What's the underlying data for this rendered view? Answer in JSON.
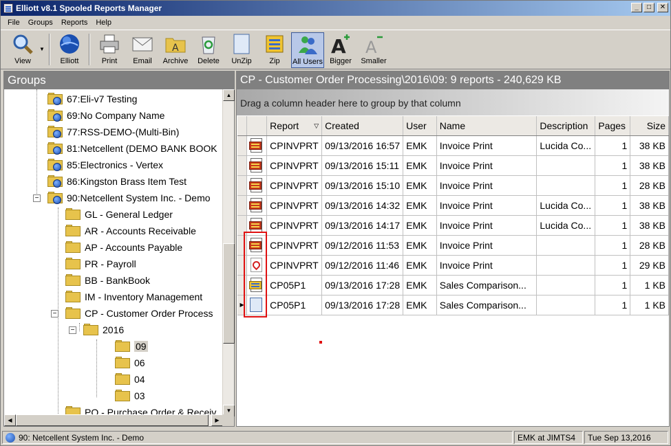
{
  "window": {
    "title": "Elliott v8.1 Spooled Reports Manager"
  },
  "menu": [
    "File",
    "Groups",
    "Reports",
    "Help"
  ],
  "toolbar": {
    "view": "View",
    "elliott": "Elliott",
    "print": "Print",
    "email": "Email",
    "archive": "Archive",
    "delete": "Delete",
    "unzip": "UnZip",
    "zip": "Zip",
    "all_users": "All Users",
    "bigger": "Bigger",
    "smaller": "Smaller"
  },
  "groups": {
    "header": "Groups",
    "tree": [
      {
        "label": "67:Eli-v7 Testing",
        "type": "company"
      },
      {
        "label": "69:No Company Name",
        "type": "company"
      },
      {
        "label": "77:RSS-DEMO-(Multi-Bin)",
        "type": "company"
      },
      {
        "label": "81:Netcellent (DEMO BANK BOOK",
        "type": "company"
      },
      {
        "label": "85:Electronics - Vertex",
        "type": "company"
      },
      {
        "label": "86:Kingston Brass Item Test",
        "type": "company"
      },
      {
        "label": "90:Netcellent System Inc. - Demo",
        "type": "company",
        "expander": "−"
      },
      {
        "label": "GL - General Ledger",
        "type": "folder"
      },
      {
        "label": "AR - Accounts Receivable",
        "type": "folder"
      },
      {
        "label": "AP - Accounts Payable",
        "type": "folder"
      },
      {
        "label": "PR - Payroll",
        "type": "folder"
      },
      {
        "label": "BB - BankBook",
        "type": "folder"
      },
      {
        "label": "IM - Inventory Management",
        "type": "folder"
      },
      {
        "label": "CP - Customer Order Process",
        "type": "folder",
        "expander": "−"
      },
      {
        "label": "2016",
        "type": "folder",
        "expander": "−"
      },
      {
        "label": "09",
        "type": "folder",
        "selected": true
      },
      {
        "label": "06",
        "type": "folder"
      },
      {
        "label": "04",
        "type": "folder"
      },
      {
        "label": "03",
        "type": "folder"
      },
      {
        "label": "PO - Purchase Order & Receiv",
        "type": "folder"
      }
    ]
  },
  "reports": {
    "header": "CP - Customer Order Processing\\2016\\09:  9 reports  -  240,629 KB",
    "group_hint": "Drag a column header here to group by that column",
    "columns": {
      "report": "Report",
      "created": "Created",
      "user": "User",
      "name": "Name",
      "description": "Description",
      "pages": "Pages",
      "size": "Size"
    },
    "rows": [
      {
        "icon": "report-red",
        "report": "CPINVPRT",
        "created": "09/13/2016 16:57",
        "user": "EMK",
        "name": "Invoice Print",
        "description": "Lucida Co...",
        "pages": "1",
        "size": "38 KB"
      },
      {
        "icon": "report-red",
        "report": "CPINVPRT",
        "created": "09/13/2016 15:11",
        "user": "EMK",
        "name": "Invoice Print",
        "description": "",
        "pages": "1",
        "size": "38 KB"
      },
      {
        "icon": "report-red",
        "report": "CPINVPRT",
        "created": "09/13/2016 15:10",
        "user": "EMK",
        "name": "Invoice Print",
        "description": "",
        "pages": "1",
        "size": "28 KB"
      },
      {
        "icon": "report-red",
        "report": "CPINVPRT",
        "created": "09/13/2016 14:32",
        "user": "EMK",
        "name": "Invoice Print",
        "description": "Lucida Co...",
        "pages": "1",
        "size": "38 KB"
      },
      {
        "icon": "report-red",
        "report": "CPINVPRT",
        "created": "09/13/2016 14:17",
        "user": "EMK",
        "name": "Invoice Print",
        "description": "Lucida Co...",
        "pages": "1",
        "size": "38 KB"
      },
      {
        "icon": "report-red",
        "report": "CPINVPRT",
        "created": "09/12/2016 11:53",
        "user": "EMK",
        "name": "Invoice Print",
        "description": "",
        "pages": "1",
        "size": "28 KB"
      },
      {
        "icon": "pdf",
        "report": "CPINVPRT",
        "created": "09/12/2016 11:46",
        "user": "EMK",
        "name": "Invoice Print",
        "description": "",
        "pages": "1",
        "size": "29 KB"
      },
      {
        "icon": "report-yellow",
        "report": "CP05P1",
        "created": "09/13/2016 17:28",
        "user": "EMK",
        "name": "Sales Comparison...",
        "description": "",
        "pages": "1",
        "size": "1 KB"
      },
      {
        "icon": "blank",
        "report": "CP05P1",
        "created": "09/13/2016 17:28",
        "user": "EMK",
        "name": "Sales Comparison...",
        "description": "",
        "pages": "1",
        "size": "1 KB",
        "current": true
      }
    ]
  },
  "status": {
    "company": "90: Netcellent System Inc. - Demo",
    "user": "EMK at JIMTS4",
    "date": "Tue Sep 13,2016"
  }
}
